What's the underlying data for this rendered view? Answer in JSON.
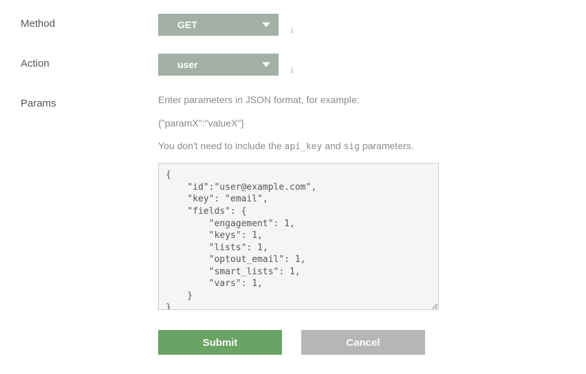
{
  "labels": {
    "method": "Method",
    "action": "Action",
    "params": "Params"
  },
  "method": {
    "selected": "GET"
  },
  "action": {
    "selected": "user"
  },
  "params_help": {
    "line1": "Enter parameters in JSON format, for example:",
    "example": "{\"paramX\":\"valueX\"}",
    "line2_prefix": "You don't need to include the ",
    "code1": "api_key",
    "line2_mid": " and ",
    "code2": "sig",
    "line2_suffix": " parameters."
  },
  "params_value": "{\n    \"id\":\"user@example.com\",\n    \"key\": \"email\",\n    \"fields\": {\n        \"engagement\": 1,\n        \"keys\": 1,\n        \"lists\": 1,\n        \"optout_email\": 1,\n        \"smart_lists\": 1,\n        \"vars\": 1,\n    }\n}",
  "buttons": {
    "submit": "Submit",
    "cancel": "Cancel"
  }
}
